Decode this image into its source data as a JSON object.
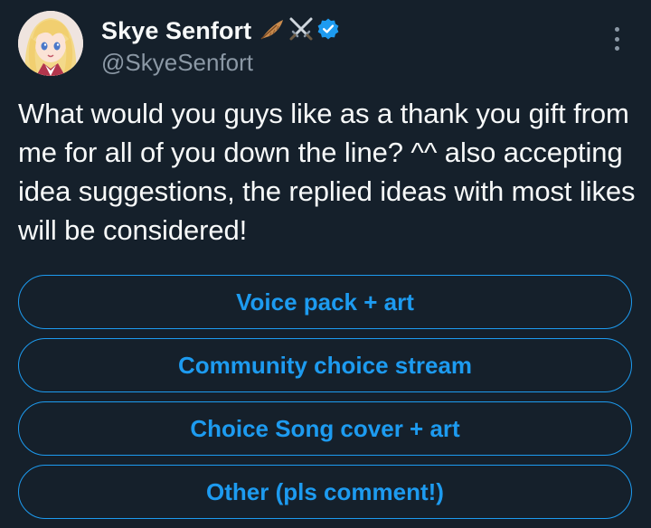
{
  "author": {
    "display_name": "Skye Senfort",
    "handle": "@SkyeSenfort",
    "name_icons": [
      "feather-icon",
      "crossed-swords-icon",
      "verified-badge-icon"
    ]
  },
  "tweet": {
    "text": "What would you guys like as a thank you gift from me for all of you down the line? ^^ also accepting idea suggestions, the replied ideas with most likes will be considered!"
  },
  "poll": {
    "options": [
      {
        "label": "Voice pack + art"
      },
      {
        "label": "Community choice stream"
      },
      {
        "label": "Choice Song cover + art"
      },
      {
        "label": "Other (pls comment!)"
      }
    ]
  },
  "colors": {
    "background": "#15202b",
    "text_primary": "#f7f9f9",
    "text_secondary": "#8b98a5",
    "accent": "#1d9bf0"
  }
}
